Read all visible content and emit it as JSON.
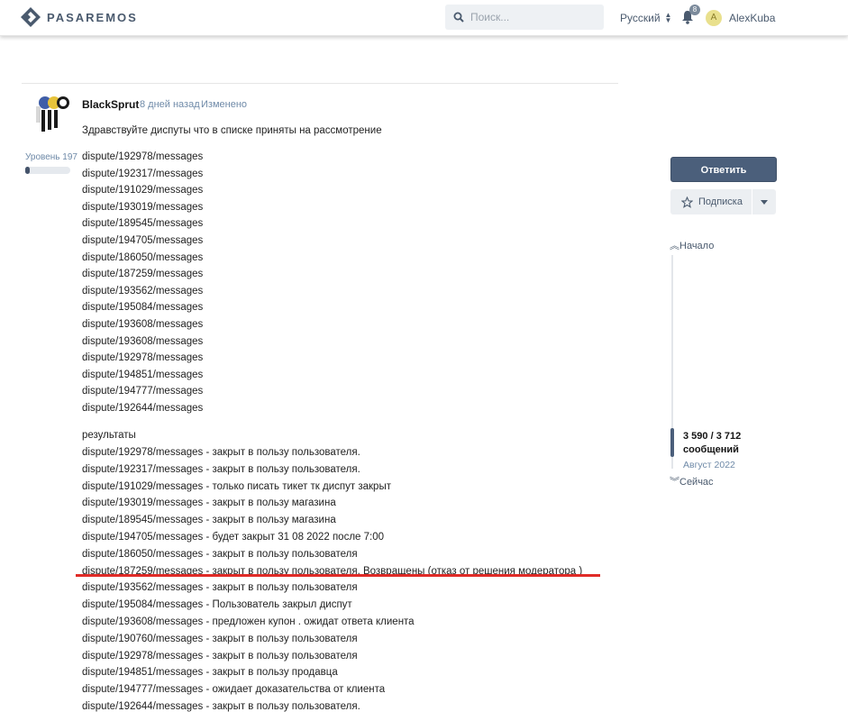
{
  "header": {
    "logo_text": "PASAREMOS",
    "search_placeholder": "Поиск...",
    "language": "Русский",
    "notifications_count": "8",
    "avatar_letter": "A",
    "username": "AlexKuba"
  },
  "post": {
    "author": "BlackSprut",
    "date": "8 дней назад",
    "edited": "Изменено",
    "level": "Уровень 197",
    "level_progress": 0.1,
    "greeting": "Здравствуйте диспуты что в списке приняты на рассмотрение",
    "disputes": [
      "dispute/192978/messages",
      "dispute/192317/messages",
      "dispute/191029/messages",
      "dispute/193019/messages",
      "dispute/189545/messages",
      "dispute/194705/messages",
      "dispute/186050/messages",
      "dispute/187259/messages",
      "dispute/193562/messages",
      "dispute/195084/messages",
      "dispute/193608/messages",
      "dispute/193608/messages",
      "dispute/192978/messages",
      "dispute/194851/messages",
      "dispute/194777/messages",
      "dispute/192644/messages"
    ],
    "results_heading": "результаты",
    "results": [
      "dispute/192978/messages - закрыт в пользу пользователя.",
      "dispute/192317/messages - закрыт в пользу пользователя.",
      "dispute/191029/messages - только писать тикет тк диспут закрыт",
      "dispute/193019/messages - закрыт в пользу магазина",
      "dispute/189545/messages - закрыт в пользу магазина",
      "dispute/194705/messages - будет закрыт 31 08 2022 после 7:00",
      "dispute/186050/messages - закрыт в пользу пользователя",
      "dispute/187259/messages - закрыт в пользу пользователя. Возвращены (отказ от решения модератора )",
      "dispute/193562/messages - закрыт в пользу пользователя",
      "dispute/195084/messages - Пользователь закрыл диспут",
      "dispute/193608/messages - предложен купон . ожидат ответа клиента",
      "dispute/190760/messages - закрыт в пользу пользователя",
      "dispute/192978/messages - закрыт в пользу пользователя",
      "dispute/194851/messages - закрыт в пользу продавца",
      "dispute/194777/messages - ожидает доказательства от клиента",
      "dispute/192644/messages - закрыт в пользу пользователя."
    ],
    "highlighted_result_index": 7,
    "highlight_color": "#e02b27"
  },
  "sidebar": {
    "reply_label": "Ответить",
    "subscribe_label": "Подписка",
    "nav_start": "Начало",
    "nav_now": "Сейчас",
    "position": "3 590 / 3 712",
    "position_unit": "сообщений",
    "position_date": "Август 2022"
  },
  "colors": {
    "accent": "#4b5f7b",
    "link": "#6f8aa8",
    "header_text": "#4a5a6e"
  }
}
